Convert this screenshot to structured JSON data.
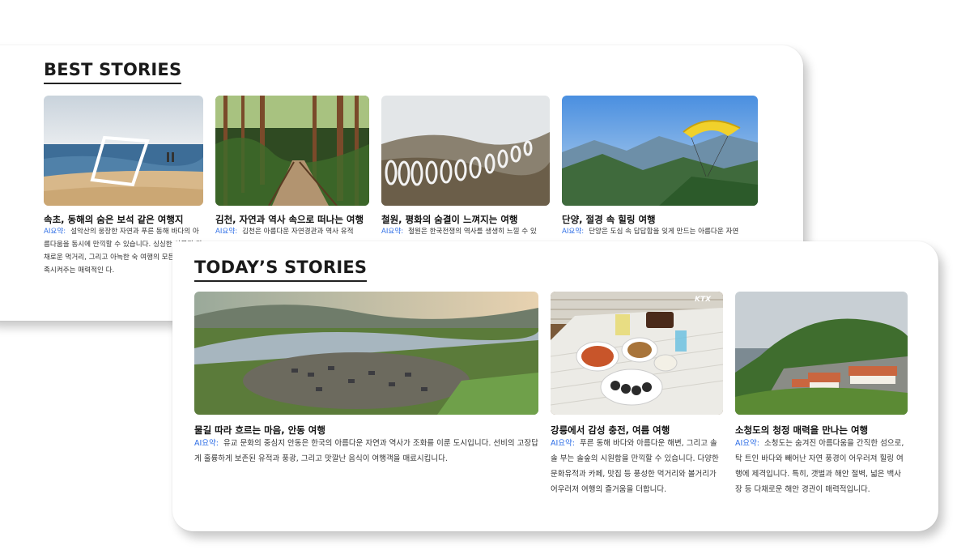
{
  "best": {
    "title": "BEST STORIES",
    "cards": [
      {
        "title": "속초, 동해의 숨은 보석 같은 여행지",
        "ai_label": "AI요약:",
        "summary": "설악산의 웅장한 자연과 푸른 동해 바다의 아름다움을 동시에 만끽할 수 있습니다. 싱싱한 산물과 다채로운 먹거리, 그리고 아늑한 숙 여행의 모든 것을 충족시켜주는 매력적인 다."
      },
      {
        "title": "김천, 자연과 역사 속으로 떠나는 여행",
        "ai_label": "AI요약:",
        "summary": "김천은 아름다운 자연경관과 역사 유적"
      },
      {
        "title": "철원, 평화의 숨결이 느껴지는 여행",
        "ai_label": "AI요약:",
        "summary": "철원은 한국전쟁의 역사를 생생히 느낄 수 있"
      },
      {
        "title": "단양, 절경 속 힐링 여행",
        "ai_label": "AI요약:",
        "summary": "단양은 도심 속 답답함을 잊게 만드는 아름다운 자연"
      }
    ]
  },
  "today": {
    "title": "TODAY’S STORIES",
    "cards": [
      {
        "title": "물길 따라 흐르는 마음, 안동 여행",
        "ai_label": "AI요약:",
        "summary": "유교 문화의 중심지 안동은 한국의 아름다운 자연과 역사가 조화를 이룬 도시입니다. 선비의 고장답게 훌륭하게 보존된 유적과 풍광, 그리고 맛깔난 음식이 여행객을 매료시킵니다."
      },
      {
        "title": "강릉에서 감성 충전, 여름 여행",
        "ai_label": "AI요약:",
        "summary": "푸른 동해 바다와 아름다운 해변, 그리고 솔솔 부는 솔숲의 시원함을 만끽할 수 있습니다. 다양한 문화유적과 카페, 맛집 등 풍성한 먹거리와 볼거리가 어우러져 여행의 즐거움을 더합니다.",
        "badge": "KTX"
      },
      {
        "title": "소청도의 청정 매력을 만나는 여행",
        "ai_label": "AI요약:",
        "summary": "소청도는 숨겨진 아름다움을 간직한 섬으로, 탁 트인 바다와 빼어난 자연 풍경이 어우러져 힐링 여행에 제격입니다. 특히, 갯벌과 해안 절벽, 넓은 백사장 등 다채로운 해안 경관이 매력적입니다."
      }
    ]
  }
}
